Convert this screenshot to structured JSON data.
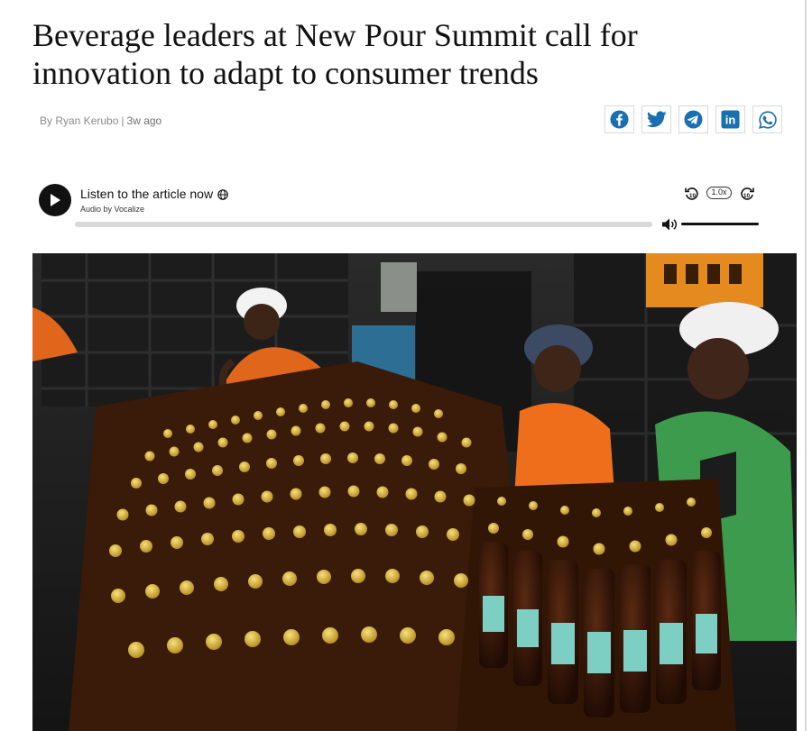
{
  "article": {
    "headline": "Beverage leaders at New Pour Summit call for innovation to adapt to consumer trends",
    "byline_author": "By Ryan Kerubo",
    "byline_separator": "|",
    "byline_time": "3w ago"
  },
  "share": {
    "items": [
      "facebook-icon",
      "twitter-icon",
      "telegram-icon",
      "linkedin-icon",
      "whatsapp-icon"
    ],
    "linkedin_text": "in",
    "brand_color": "#1a6fb0"
  },
  "audio_player": {
    "title": "Listen to the article now",
    "provider": "Audio by Vocalize",
    "speed": "1.0x",
    "rewind_seconds": "10",
    "forward_seconds": "10",
    "progress": 0,
    "volume": 1.0
  },
  "hero_image": {
    "icon": "photo-factory-workers-bottles"
  }
}
